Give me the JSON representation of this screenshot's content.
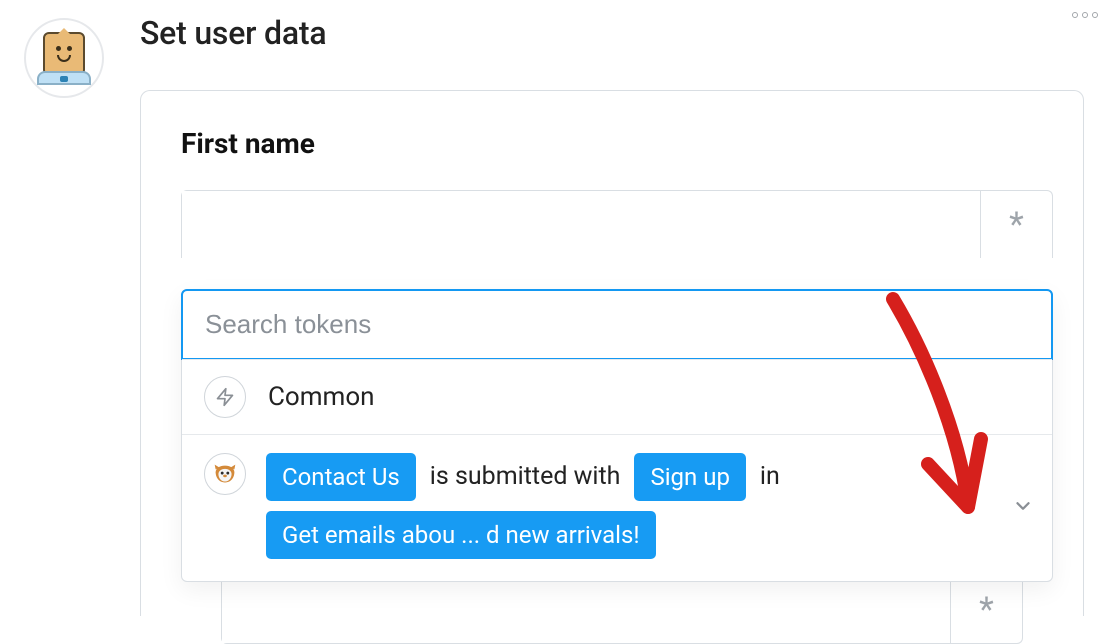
{
  "header": {
    "title": "Set user data",
    "more_icon_name": "more-icon"
  },
  "avatar": {
    "name": "paper-bag-character",
    "alt": "User avatar"
  },
  "field": {
    "label": "First name",
    "asterisk": "*"
  },
  "dropdown": {
    "search_placeholder": "Search tokens",
    "sections": [
      {
        "icon": "lightning-icon",
        "label": "Common"
      }
    ],
    "trigger": {
      "icon": "wpforms-mascot-icon",
      "parts": [
        {
          "type": "chip",
          "text": "Contact Us"
        },
        {
          "type": "text",
          "text": "is submitted with"
        },
        {
          "type": "chip",
          "text": "Sign up"
        },
        {
          "type": "text",
          "text": "in"
        },
        {
          "type": "chip",
          "text": "Get emails abou ... d new arrivals!"
        }
      ]
    }
  }
}
